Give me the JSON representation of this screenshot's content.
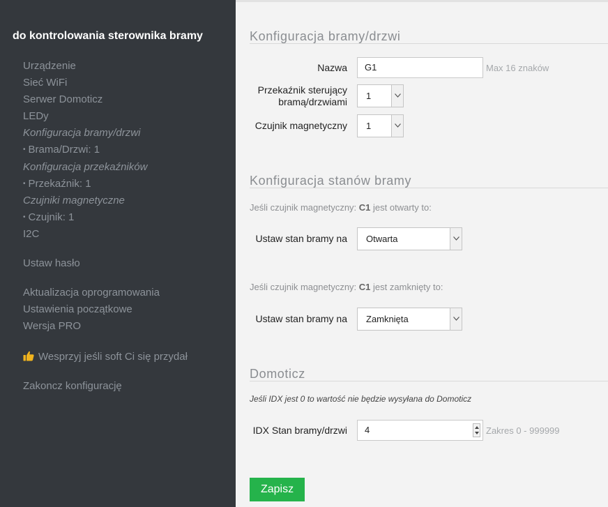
{
  "sidebar": {
    "title": "do kontrolowania sterownika bramy",
    "items": [
      {
        "label": "Urządzenie"
      },
      {
        "label": "Sieć WiFi"
      },
      {
        "label": "Serwer Domoticz"
      },
      {
        "label": "LEDy"
      },
      {
        "label": "Konfiguracja bramy/drzwi"
      },
      {
        "label": "Brama/Drzwi: 1"
      },
      {
        "label": "Konfiguracja przekaźników"
      },
      {
        "label": "Przekaźnik: 1"
      },
      {
        "label": "Czujniki magnetyczne"
      },
      {
        "label": "Czujnik: 1"
      },
      {
        "label": "I2C"
      },
      {
        "label": "Ustaw hasło"
      },
      {
        "label": "Aktualizacja oprogramowania"
      },
      {
        "label": "Ustawienia początkowe"
      },
      {
        "label": "Wersja PRO"
      },
      {
        "label": "Wesprzyj jeśli soft Ci się przydał"
      },
      {
        "label": "Zakoncz konfigurację"
      }
    ],
    "bullet": "•",
    "support_icon": "thumbs-up-icon"
  },
  "gate_config": {
    "heading": "Konfiguracja bramy/drzwi",
    "name_label": "Nazwa",
    "name_value": "G1",
    "name_hint": "Max 16 znaków",
    "relay_label_line1": "Przekaźnik sterujący",
    "relay_label_line2": "bramą/drzwiami",
    "relay_value": "1",
    "sensor_label": "Czujnik magnetyczny",
    "sensor_value": "1"
  },
  "states_config": {
    "heading": "Konfiguracja stanów bramy",
    "open_desc_prefix": "Jeśli czujnik magnetyczny:",
    "open_desc_sensor": "C1",
    "open_desc_suffix": "jest otwarty to:",
    "open_label": "Ustaw stan bramy na",
    "open_value": "Otwarta",
    "closed_desc_prefix": "Jeśli czujnik magnetyczny:",
    "closed_desc_sensor": "C1",
    "closed_desc_suffix": "jest zamknięty to:",
    "closed_label": "Ustaw stan bramy na",
    "closed_value": "Zamknięta"
  },
  "domoticz": {
    "heading": "Domoticz",
    "note": "Jeśli IDX jest 0 to wartość nie będzie wysyłana do Domoticz",
    "idx_label": "IDX Stan bramy/drzwi",
    "idx_value": "4",
    "idx_hint": "Zakres 0 - 999999"
  },
  "save_label": "Zapisz",
  "colors": {
    "sidebar_bg": "#34383d",
    "main_bg": "#f3f3f3",
    "accent_green": "#25b34b",
    "support_icon": "#f0b31e"
  }
}
